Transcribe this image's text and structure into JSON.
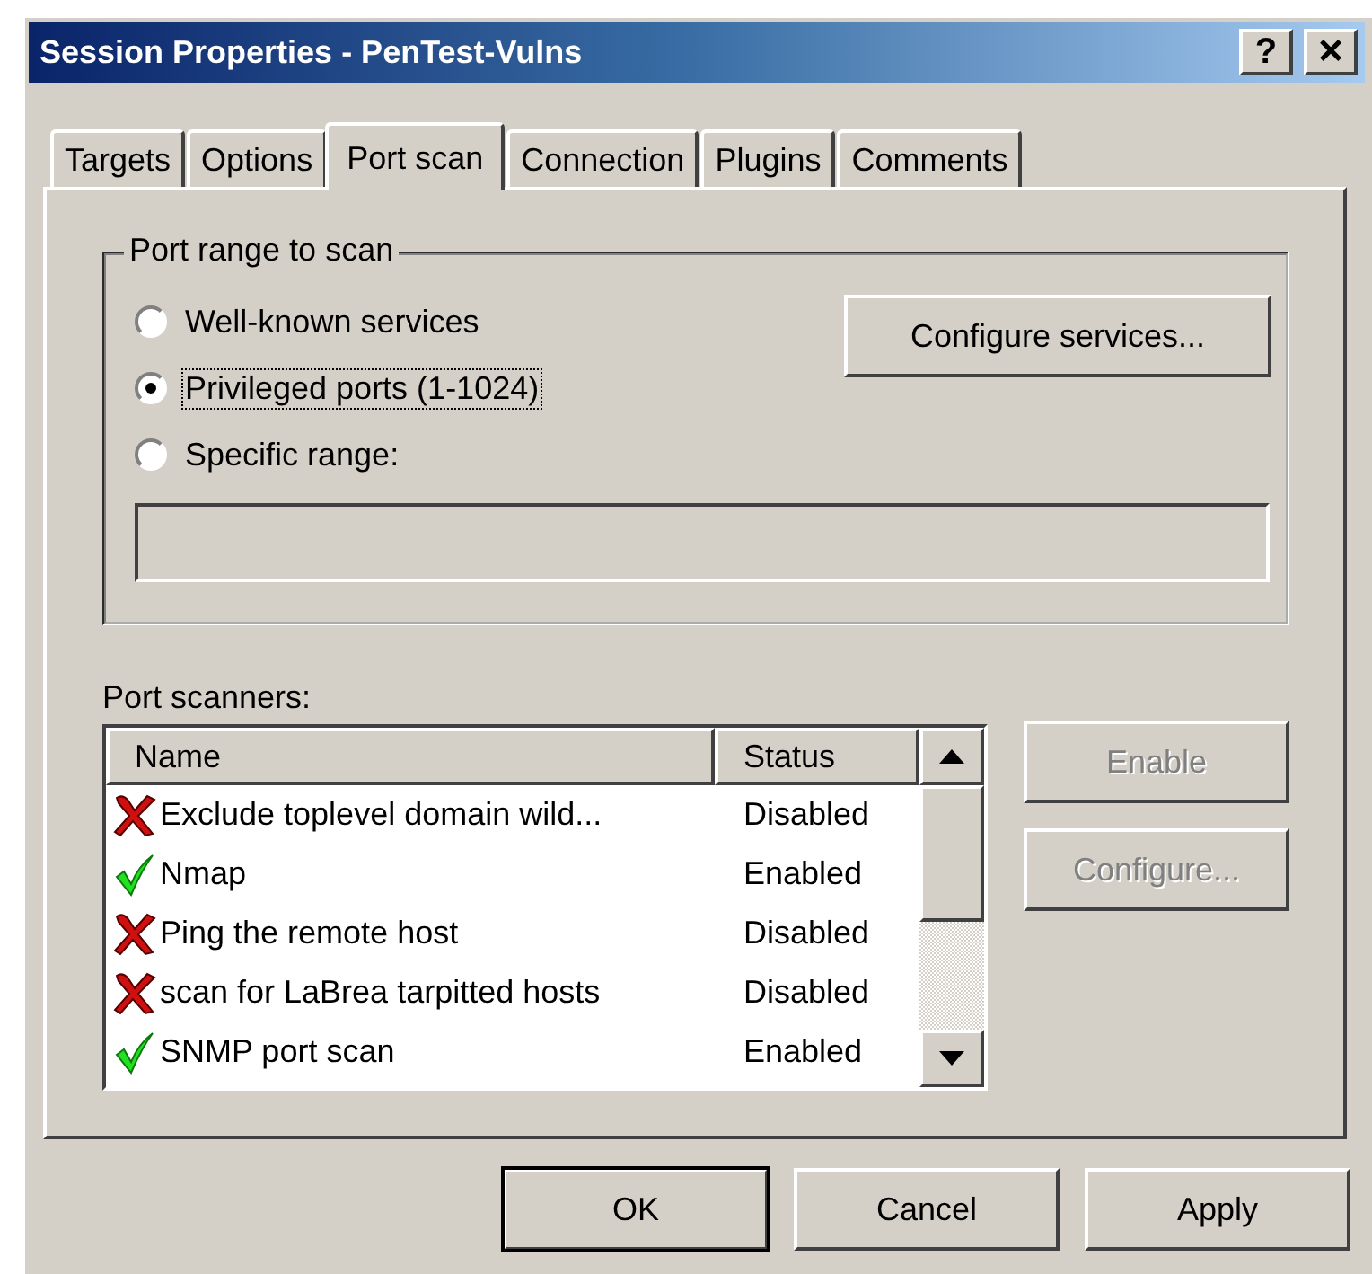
{
  "window": {
    "title": "Session Properties - PenTest-Vulns",
    "title_buttons": [
      {
        "kind": "help",
        "label": "?"
      },
      {
        "kind": "close",
        "label": "×"
      }
    ]
  },
  "tabs": [
    {
      "label": "Targets",
      "selected": false
    },
    {
      "label": "Options",
      "selected": false
    },
    {
      "label": "Port scan",
      "selected": true
    },
    {
      "label": "Connection",
      "selected": false
    },
    {
      "label": "Plugins",
      "selected": false
    },
    {
      "label": "Comments",
      "selected": false
    }
  ],
  "port_range": {
    "legend": "Port range to scan",
    "options": [
      {
        "label": "Well-known services",
        "selected": false,
        "focused": false
      },
      {
        "label": "Privileged ports (1-1024)",
        "selected": true,
        "focused": true
      },
      {
        "label": "Specific range:",
        "selected": false,
        "focused": false
      }
    ],
    "configure_button": {
      "label": "Configure services...",
      "disabled": false
    },
    "range_field": {
      "disabled": true
    }
  },
  "port_scanners": {
    "label": "Port scanners:",
    "columns": [
      "Name",
      "Status"
    ],
    "rows": [
      {
        "name": "Exclude toplevel domain wild...",
        "status": "Disabled",
        "enabled": false
      },
      {
        "name": "Nmap",
        "status": "Enabled",
        "enabled": true
      },
      {
        "name": "Ping the remote host",
        "status": "Disabled",
        "enabled": false
      },
      {
        "name": "scan for LaBrea tarpitted hosts",
        "status": "Disabled",
        "enabled": false
      },
      {
        "name": "SNMP port scan",
        "status": "Enabled",
        "enabled": true
      }
    ],
    "buttons": [
      {
        "label": "Enable",
        "disabled": true
      },
      {
        "label": "Configure...",
        "disabled": true
      }
    ]
  },
  "buttons": [
    {
      "label": "OK",
      "default": true
    },
    {
      "label": "Cancel",
      "default": false
    },
    {
      "label": "Apply",
      "default": false
    }
  ]
}
